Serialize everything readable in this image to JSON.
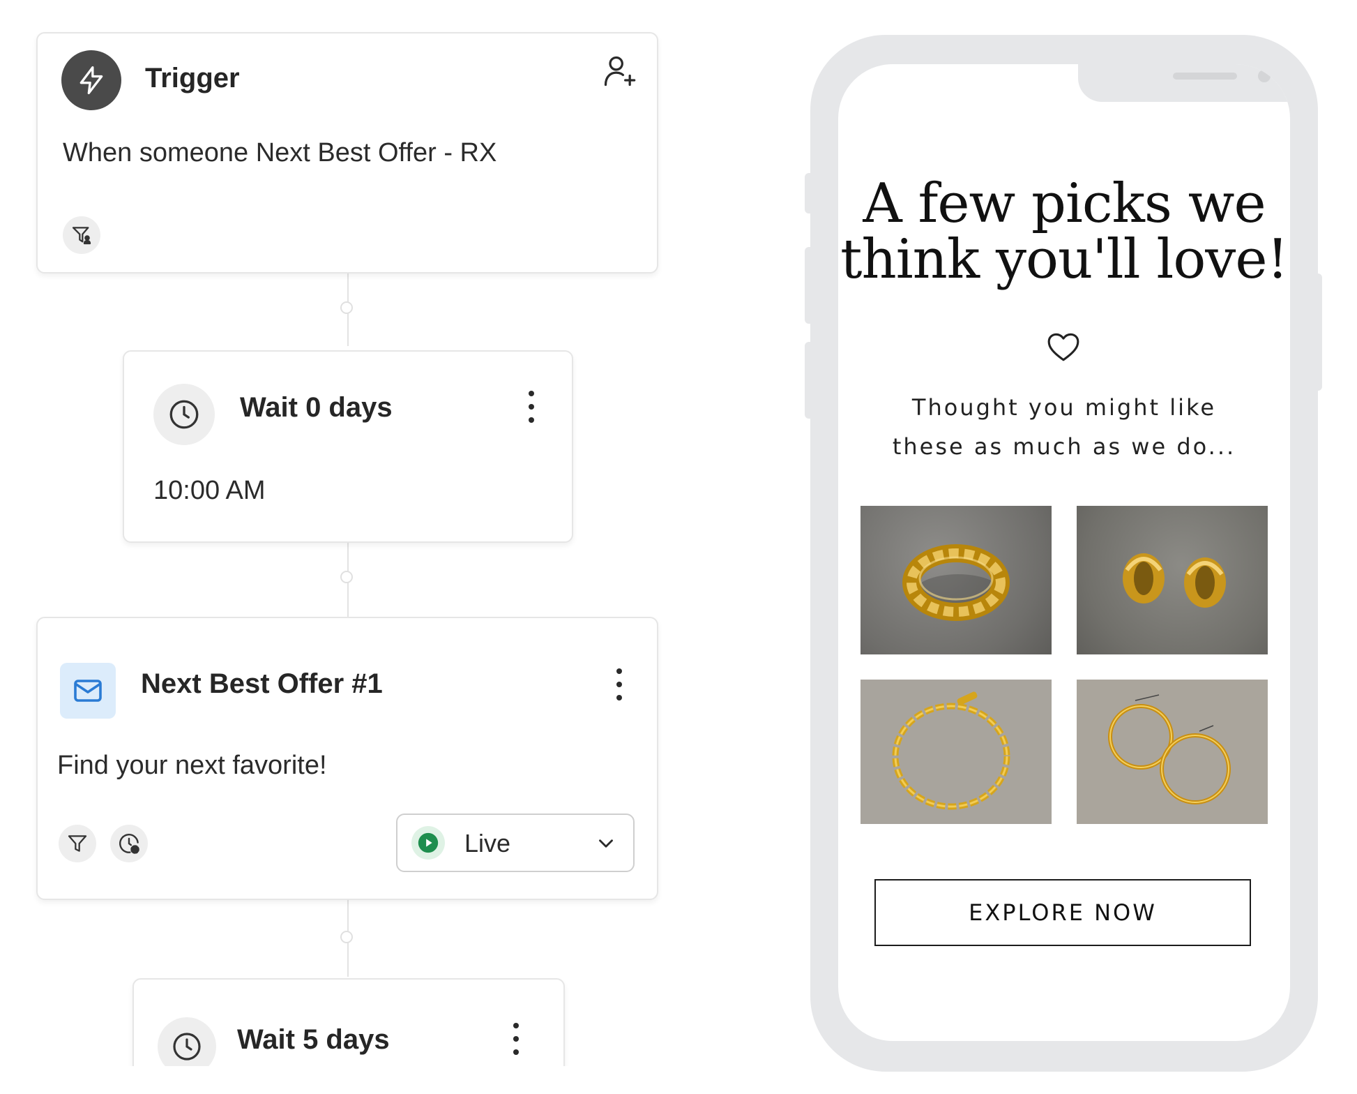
{
  "trigger": {
    "title": "Trigger",
    "description": "When someone Next Best Offer - RX",
    "icons": [
      "lightning-bolt-icon",
      "add-user-icon",
      "filter-person-icon"
    ]
  },
  "wait1": {
    "title": "Wait 0 days",
    "time": "10:00 AM",
    "icons": [
      "clock-icon",
      "more-vertical-icon"
    ]
  },
  "email": {
    "title": "Next Best Offer #1",
    "subject": "Find your next favorite!",
    "status": "Live",
    "icons": [
      "envelope-icon",
      "more-vertical-icon",
      "filter-icon",
      "clock-settings-icon",
      "play-icon",
      "chevron-down-icon"
    ],
    "status_color": "#1e8e4e"
  },
  "wait2": {
    "title": "Wait 5 days",
    "icons": [
      "clock-icon",
      "more-vertical-icon"
    ]
  },
  "preview": {
    "headline_line1": "A few picks we",
    "headline_line2": "think you'll love!",
    "subtext_line1": "Thought you might like",
    "subtext_line2": "these as much as we do...",
    "cta_label": "EXPLORE NOW",
    "products": [
      "braided-gold-ring",
      "gold-huggie-earrings",
      "gold-chain-bracelet",
      "gold-hoop-earrings"
    ],
    "icons": [
      "heart-icon"
    ]
  }
}
